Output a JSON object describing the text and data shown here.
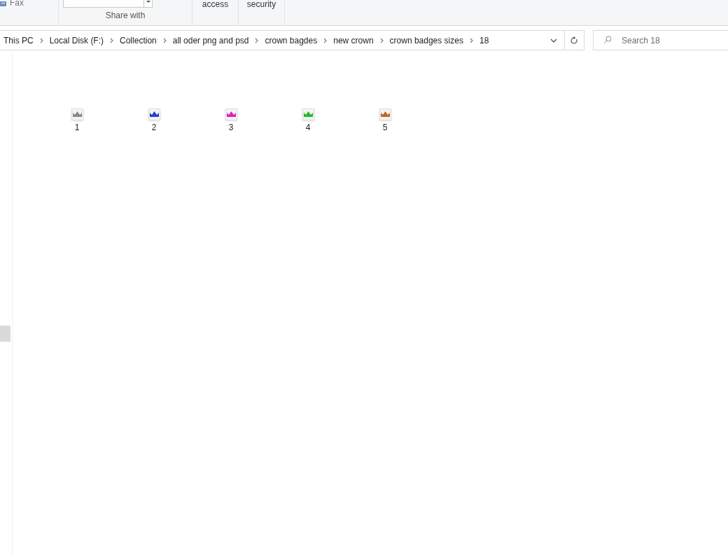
{
  "ribbon": {
    "fax_label": "Fax",
    "share_group_label": "Share with",
    "access_label": "access",
    "security_label": "security"
  },
  "address_bar": {
    "path": [
      "This PC",
      "Local Disk (F:)",
      "Collection",
      "all oder png and psd",
      "crown bagdes",
      "new crown",
      "crown badges sizes",
      "18"
    ]
  },
  "search": {
    "placeholder": "Search 18"
  },
  "files": [
    {
      "name": "1",
      "color": "#8a8a8a"
    },
    {
      "name": "2",
      "color": "#2244cc"
    },
    {
      "name": "3",
      "color": "#dd22bb"
    },
    {
      "name": "4",
      "color": "#22bb22"
    },
    {
      "name": "5",
      "color": "#c8641e"
    }
  ]
}
